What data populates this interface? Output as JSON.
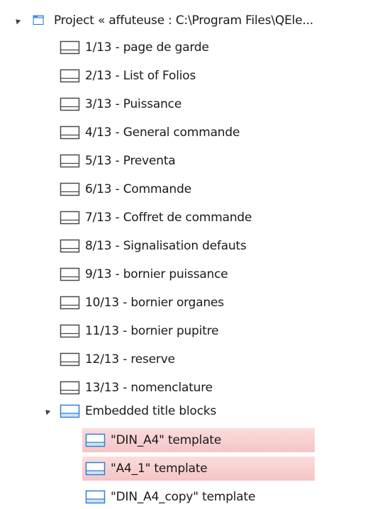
{
  "tree": {
    "project": {
      "label": "Project « affuteuse : C:\\Program Files\\QEle...",
      "icon": "project-window-icon"
    },
    "folios": [
      {
        "label": "1/13 - page de garde"
      },
      {
        "label": "2/13 - List of Folios"
      },
      {
        "label": "3/13 - Puissance"
      },
      {
        "label": "4/13 - General commande"
      },
      {
        "label": "5/13 - Preventa"
      },
      {
        "label": "6/13 - Commande"
      },
      {
        "label": "7/13 - Coffret de commande"
      },
      {
        "label": "8/13 - Signalisation defauts"
      },
      {
        "label": "9/13 - bornier puissance"
      },
      {
        "label": "10/13 - bornier organes"
      },
      {
        "label": "11/13 - bornier pupitre"
      },
      {
        "label": "12/13 - reserve"
      },
      {
        "label": "13/13 - nomenclature"
      }
    ],
    "title_blocks": {
      "label": "Embedded title blocks",
      "items": [
        {
          "label": "\"DIN_A4\" template",
          "highlighted": true
        },
        {
          "label": "\"A4_1\" template",
          "highlighted": true
        },
        {
          "label": "\"DIN_A4_copy\" template",
          "highlighted": false
        }
      ]
    }
  },
  "colors": {
    "folio_icon_stroke": "#4a4a4a",
    "template_icon_stroke": "#2f7fd6",
    "project_icon": "#2f7fd6",
    "highlight": "#f8cfcf"
  }
}
